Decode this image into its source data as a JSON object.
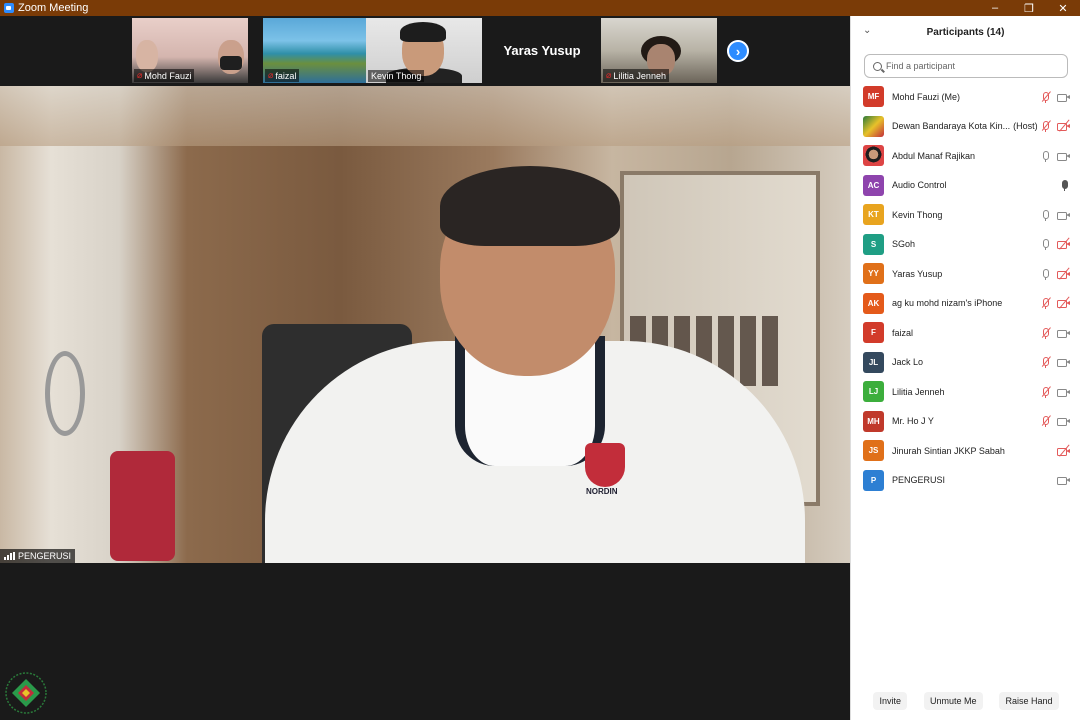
{
  "window": {
    "title": "Zoom Meeting",
    "minimize": "–",
    "restore": "❐",
    "close": "✕"
  },
  "strip": {
    "thumbs": [
      {
        "name": "Mohd Fauzi"
      },
      {
        "name": "faizal"
      },
      {
        "name": "Kevin Thong"
      },
      {
        "name": "Yaras Yusup"
      },
      {
        "name": "Lilitia Jenneh"
      }
    ],
    "next": "›"
  },
  "main": {
    "speaker": "PENGERUSI",
    "logo_text": "NORDIN"
  },
  "panel": {
    "title": "Participants (14)",
    "collapse_icon": "⌄",
    "search_placeholder": "Find a participant",
    "participants": [
      {
        "initials": "MF",
        "name": "Mohd Fauzi (Me)",
        "color": "#d23b2a",
        "mic": "off",
        "cam": "on"
      },
      {
        "initials": "",
        "name": "Dewan Bandaraya Kota Kin...",
        "host": "(Host)",
        "color": "#2a7a3a",
        "mic": "off",
        "cam": "off"
      },
      {
        "initials": "",
        "name": "Abdul Manaf Rajikan",
        "color": "#333333",
        "mic": "on",
        "cam": "on"
      },
      {
        "initials": "AC",
        "name": "Audio Control",
        "color": "#8e44ad",
        "mic": "active",
        "cam": "none"
      },
      {
        "initials": "KT",
        "name": "Kevin Thong",
        "color": "#e8a41f",
        "mic": "on",
        "cam": "on"
      },
      {
        "initials": "S",
        "name": "SGoh",
        "color": "#1f9e84",
        "mic": "on",
        "cam": "off"
      },
      {
        "initials": "YY",
        "name": "Yaras Yusup",
        "color": "#e07019",
        "mic": "on",
        "cam": "off"
      },
      {
        "initials": "AK",
        "name": "ag ku mohd nizam's iPhone",
        "color": "#e45a1a",
        "mic": "off",
        "cam": "off"
      },
      {
        "initials": "F",
        "name": "faizal",
        "color": "#d23b2a",
        "mic": "off",
        "cam": "on"
      },
      {
        "initials": "JL",
        "name": "Jack Lo",
        "color": "#34495e",
        "mic": "off",
        "cam": "on"
      },
      {
        "initials": "LJ",
        "name": "Lilitia Jenneh",
        "color": "#3cae3c",
        "mic": "off",
        "cam": "on"
      },
      {
        "initials": "MH",
        "name": "Mr. Ho J Y",
        "color": "#c0392b",
        "mic": "off",
        "cam": "on"
      },
      {
        "initials": "JS",
        "name": "Jinurah Sintian JKKP Sabah",
        "color": "#e07019",
        "mic": "none",
        "cam": "off"
      },
      {
        "initials": "P",
        "name": "PENGERUSI",
        "color": "#2d7fd3",
        "mic": "none",
        "cam": "on"
      }
    ],
    "buttons": {
      "invite": "Invite",
      "unmute": "Unmute Me",
      "raise_hand": "Raise Hand"
    }
  }
}
